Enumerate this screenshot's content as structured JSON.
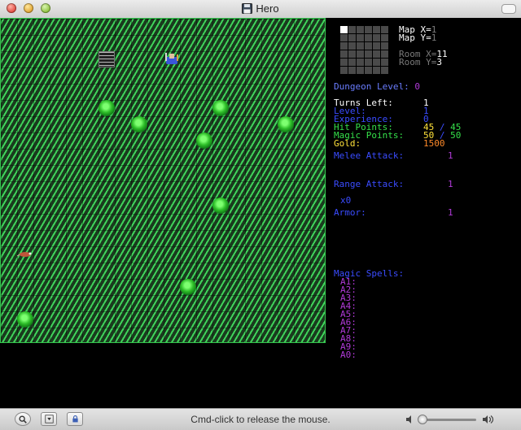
{
  "window": {
    "title": "Hero"
  },
  "map": {
    "sprites": [
      {
        "kind": "stairs",
        "name": "stairs-down-icon"
      },
      {
        "kind": "hero",
        "name": "hero-icon"
      },
      {
        "kind": "bush",
        "name": "bush-icon"
      },
      {
        "kind": "bush",
        "name": "bush-icon"
      },
      {
        "kind": "bush",
        "name": "bush-icon"
      },
      {
        "kind": "bush",
        "name": "bush-icon"
      },
      {
        "kind": "bush",
        "name": "bush-icon"
      },
      {
        "kind": "bush",
        "name": "bush-icon"
      },
      {
        "kind": "bush",
        "name": "bush-icon"
      },
      {
        "kind": "bush",
        "name": "bush-icon"
      },
      {
        "kind": "rat",
        "name": "rat-icon"
      }
    ]
  },
  "panel": {
    "minimap_current": [
      0,
      0
    ],
    "map_x_label": "Map X=",
    "map_x": "1",
    "map_y_label": "Map Y=",
    "map_y": "1",
    "room_x_label": "Room X=",
    "room_x": "11",
    "room_y_label": "Room Y=",
    "room_y": "3",
    "dungeon_label": "Dungeon Level:",
    "dungeon_level": "0",
    "turns_label": "Turns Left:",
    "turns_left": "1",
    "level_label": "Level:",
    "level": "1",
    "exp_label": "Experience:",
    "exp": "0",
    "hp_label": "Hit Points:",
    "hp": "45",
    "hp_sep": "/",
    "hp_max": "45",
    "mp_label": "Magic Points:",
    "mp": "50",
    "mp_sep": "/",
    "mp_max": "50",
    "gold_label": "Gold:",
    "gold": "1500",
    "melee_label": "Melee Attack:",
    "melee": "1",
    "range_label": "Range Attack:",
    "range": "1",
    "ammo": "x0",
    "armor_label": "Armor:",
    "armor": "1",
    "spells_label": "Magic Spells:",
    "spells": [
      "A1:",
      "A2:",
      "A3:",
      "A4:",
      "A5:",
      "A6:",
      "A7:",
      "A8:",
      "A9:",
      "A0:"
    ]
  },
  "bottombar": {
    "status": "Cmd-click to release the mouse."
  }
}
